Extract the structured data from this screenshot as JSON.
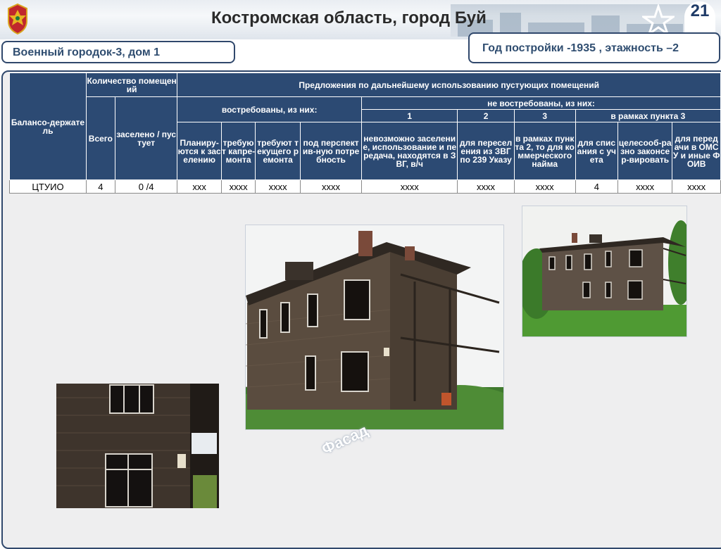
{
  "header": {
    "title": "Костромская область, город Буй",
    "page_number": "21"
  },
  "info": {
    "left": "Военный городок-3, дом  1",
    "right": "Год постройки  -1935 ,  этажность –2"
  },
  "table": {
    "h_holder": "Балансо-держатель",
    "h_count": "Количество помещений",
    "h_proposals": "Предложения по дальнейшему использованию пустующих помещений",
    "h_total": "Всего",
    "h_occupied": "заселено / пустует",
    "h_demanded": "востребованы, из них:",
    "h_not_demanded": "не востребованы, из них:",
    "h_num1": "1",
    "h_num2": "2",
    "h_num3": "3",
    "h_within3": "в рамках пункта 3",
    "h_d1": "Планиру-ются к заселению",
    "h_d2": "требуют капре-монта",
    "h_d3": "требуют текущего ремонта",
    "h_d4": "под перспектив-ную потребность",
    "h_n1": "невозможно заселение, использование и передача, находятся в ЗВГ, в/ч",
    "h_n2": "для переселения из ЗВГ по 239 Указу",
    "h_n3": "в рамках пункта 2, то для коммерческого найма",
    "h_n4": "для списания с учета",
    "h_n5": "целесооб-разно законсер-вировать",
    "h_n6": "для передачи в ОМСУ и иные ФОИВ",
    "row": [
      "ЦТУИО",
      "4",
      "0 /4",
      "ххх",
      "хххх",
      "хххх",
      "хххх",
      "хххх",
      "хххх",
      "хххх",
      "4",
      "хххх",
      "хххх"
    ]
  },
  "photo_caption": "Фасад",
  "colors": {
    "header_blue": "#2c4a73",
    "border_blue": "#30486c",
    "text_blue": "#2f4d70",
    "panel_gray": "#eeeeef"
  },
  "icons": [
    "coat-of-arms-icon",
    "star-icon"
  ]
}
